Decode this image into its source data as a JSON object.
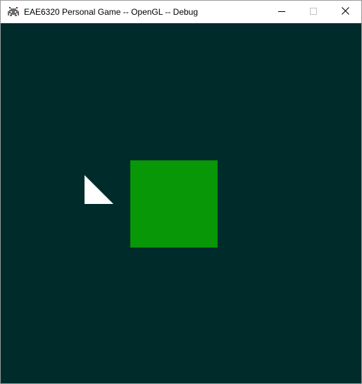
{
  "window": {
    "title": "EAE6320 Personal Game -- OpenGL -- Debug",
    "app_icon": "space-invader-icon",
    "controls": {
      "minimize_icon": "minimize-icon",
      "maximize_icon": "maximize-icon",
      "close_icon": "close-icon",
      "minimize_disabled": false,
      "maximize_disabled": true
    }
  },
  "scene": {
    "background_color": "#002b2b",
    "objects": [
      {
        "name": "green-square",
        "shape": "square",
        "color": "#079707"
      },
      {
        "name": "white-triangle",
        "shape": "triangle",
        "color": "#ffffff"
      }
    ]
  },
  "colors": {
    "titlebar": "#ffffff",
    "title_text": "#000000",
    "border": "#9a9a9a",
    "disabled_control": "#c4c4c4"
  }
}
